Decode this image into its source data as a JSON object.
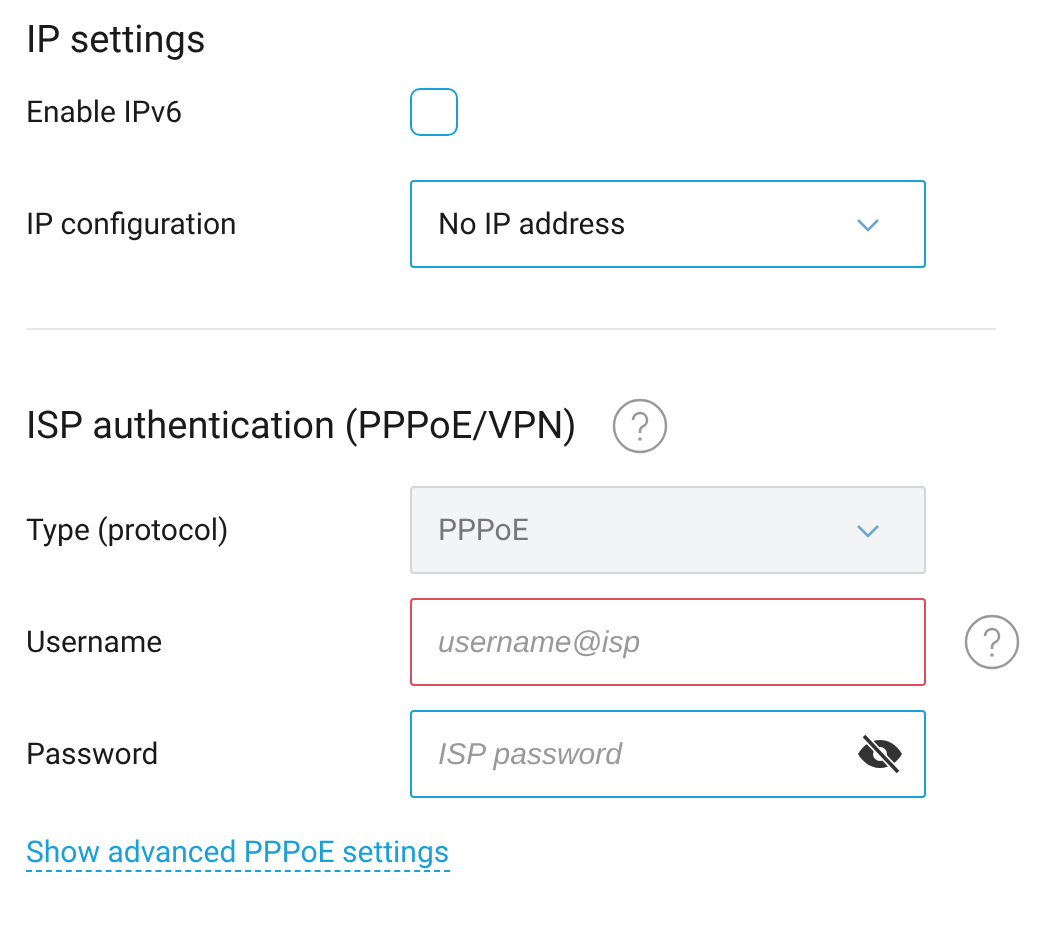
{
  "sections": [
    {
      "title": "IP settings",
      "help": false,
      "rows": [
        {
          "kind": "checkbox",
          "label": "Enable IPv6",
          "checked": false
        },
        {
          "kind": "select",
          "label": "IP configuration",
          "value": "No IP address",
          "disabled": false
        }
      ]
    },
    {
      "title": "ISP authentication (PPPoE/VPN)",
      "help": true,
      "rows": [
        {
          "kind": "select",
          "label": "Type (protocol)",
          "value": "PPPoE",
          "disabled": true
        },
        {
          "kind": "text",
          "label": "Username",
          "placeholder": "username@isp",
          "invalid": true,
          "help": true
        },
        {
          "kind": "password",
          "label": "Password",
          "placeholder": "ISP password",
          "invalid": false
        }
      ]
    }
  ],
  "link": "Show advanced PPPoE settings"
}
